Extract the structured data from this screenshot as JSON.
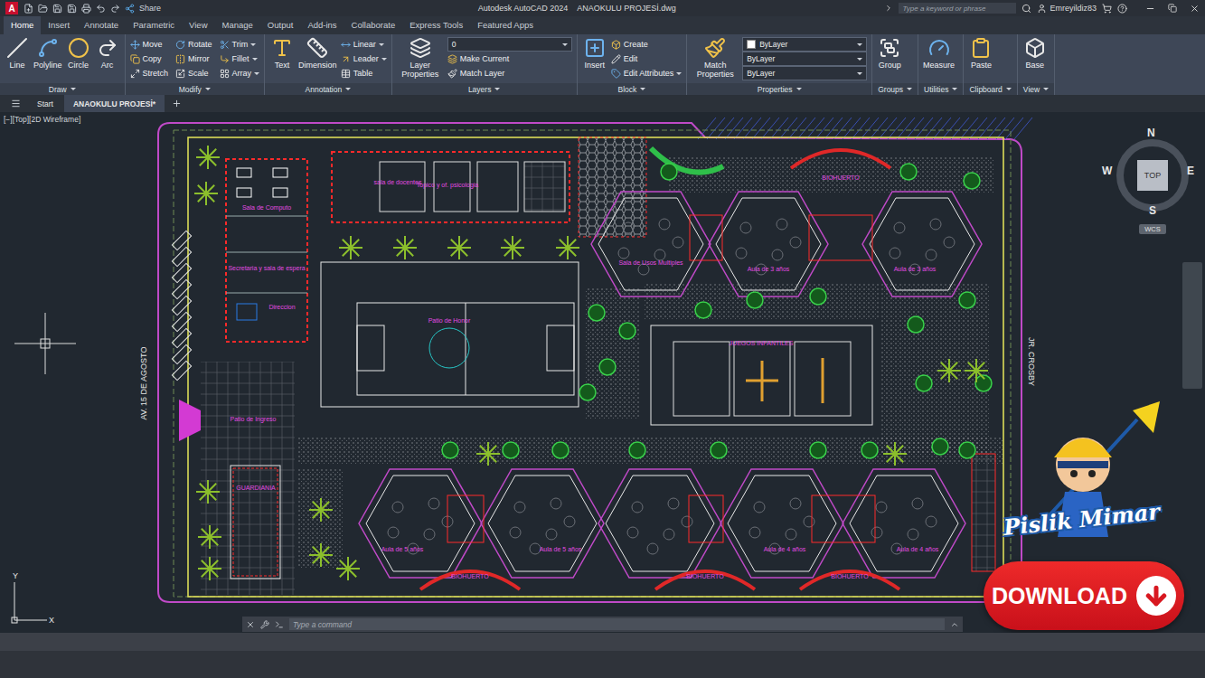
{
  "window": {
    "app_icon": "A",
    "title": "Autodesk AutoCAD 2024",
    "file": "ANAOKULU PROJESİ.dwg",
    "share": "Share",
    "search_placeholder": "Type a keyword or phrase",
    "user": "Emreyildiz83"
  },
  "ribbon_tabs": [
    {
      "label": "Home",
      "selected": true
    },
    {
      "label": "Insert",
      "selected": false
    },
    {
      "label": "Annotate",
      "selected": false
    },
    {
      "label": "Parametric",
      "selected": false
    },
    {
      "label": "View",
      "selected": false
    },
    {
      "label": "Manage",
      "selected": false
    },
    {
      "label": "Output",
      "selected": false
    },
    {
      "label": "Add-ins",
      "selected": false
    },
    {
      "label": "Collaborate",
      "selected": false
    },
    {
      "label": "Express Tools",
      "selected": false
    },
    {
      "label": "Featured Apps",
      "selected": false
    }
  ],
  "ribbon_panels": [
    {
      "title": "Draw",
      "tools": [
        {
          "label": "Line",
          "kind": "big",
          "menu": false
        },
        {
          "label": "Polyline",
          "kind": "big",
          "menu": false
        },
        {
          "label": "Circle",
          "kind": "big",
          "menu": false
        },
        {
          "label": "Arc",
          "kind": "big",
          "menu": false
        }
      ]
    },
    {
      "title": "Modify",
      "tools": [
        {
          "label": "Move",
          "kind": "small",
          "menu": false
        },
        {
          "label": "Copy",
          "kind": "small",
          "menu": false
        },
        {
          "label": "Stretch",
          "kind": "small",
          "menu": false
        },
        {
          "label": "Rotate",
          "kind": "small",
          "menu": false
        },
        {
          "label": "Mirror",
          "kind": "small",
          "menu": false
        },
        {
          "label": "Scale",
          "kind": "small",
          "menu": false
        },
        {
          "label": "Trim",
          "kind": "small",
          "menu": true
        },
        {
          "label": "Fillet",
          "kind": "small",
          "menu": true
        },
        {
          "label": "Array",
          "kind": "small",
          "menu": true
        }
      ]
    },
    {
      "title": "Annotation",
      "tools": [
        {
          "label": "Text",
          "kind": "big",
          "menu": false
        },
        {
          "label": "Dimension",
          "kind": "big",
          "menu": false
        },
        {
          "label": "Linear",
          "kind": "small",
          "menu": true
        },
        {
          "label": "Leader",
          "kind": "small",
          "menu": true
        },
        {
          "label": "Table",
          "kind": "small",
          "menu": false
        }
      ]
    },
    {
      "title": "Layers",
      "tools": [
        {
          "label": "Layer Properties",
          "kind": "big",
          "menu": false
        },
        {
          "label": "0",
          "kind": "dropdown",
          "swatch": false
        },
        {
          "label": "Make Current",
          "kind": "small",
          "menu": false
        },
        {
          "label": "Match Layer",
          "kind": "small",
          "menu": false
        }
      ]
    },
    {
      "title": "Block",
      "tools": [
        {
          "label": "Insert",
          "kind": "big",
          "menu": false
        },
        {
          "label": "Create",
          "kind": "small",
          "menu": false
        },
        {
          "label": "Edit",
          "kind": "small",
          "menu": false
        },
        {
          "label": "Edit Attributes",
          "kind": "small",
          "menu": true
        }
      ]
    },
    {
      "title": "Properties",
      "tools": [
        {
          "label": "Match Properties",
          "kind": "big",
          "menu": false
        },
        {
          "label": "ByLayer",
          "kind": "dropdown",
          "swatch": true
        },
        {
          "label": "ByLayer",
          "kind": "dropdown",
          "swatch": false
        },
        {
          "label": "ByLayer",
          "kind": "dropdown",
          "swatch": false
        }
      ]
    },
    {
      "title": "Groups",
      "tools": [
        {
          "label": "Group",
          "kind": "big",
          "menu": false
        }
      ]
    },
    {
      "title": "Utilities",
      "tools": [
        {
          "label": "Measure",
          "kind": "big",
          "menu": false
        }
      ]
    },
    {
      "title": "Clipboard",
      "tools": [
        {
          "label": "Paste",
          "kind": "big",
          "menu": false
        }
      ]
    },
    {
      "title": "View",
      "tools": [
        {
          "label": "Base",
          "kind": "big",
          "menu": false
        }
      ]
    }
  ],
  "file_tabs": [
    {
      "label": "Start",
      "selected": false
    },
    {
      "label": "ANAOKULU PROJESİ*",
      "selected": true
    }
  ],
  "viewport_label": "[−][Top][2D Wireframe]",
  "viewcube": {
    "top": "TOP",
    "n": "N",
    "s": "S",
    "e": "E",
    "w": "W",
    "wcs": "WCS"
  },
  "drawing": {
    "streets": [
      "AV. 15 DE AGOSTO",
      "JR. CROSBY"
    ],
    "labels": [
      "Sala de Computo",
      "Secretaria y sala de espera",
      "Direccion",
      "Patio de Ingreso",
      "GUARDIANIA",
      "sala de docentes",
      "Topico y of. psicologia",
      "Sala de Usos Multiples",
      "Aula de 3 años",
      "Aula de 3 años",
      "Aula de 5 años",
      "Aula de 5 años",
      "Aula de 4 años",
      "Aula de 4 años",
      "BIOHUERTO",
      "BIOHUERTO",
      "BIOHUERTO",
      "BIOHUERTO",
      "JUEGOS INFANTILES",
      "Patio de Honor"
    ]
  },
  "ucs": {
    "x": "X",
    "y": "Y"
  },
  "command_line": {
    "placeholder": "Type a command"
  },
  "watermark": {
    "brand": "Pislik Mimar",
    "button": "DOWNLOAD"
  }
}
